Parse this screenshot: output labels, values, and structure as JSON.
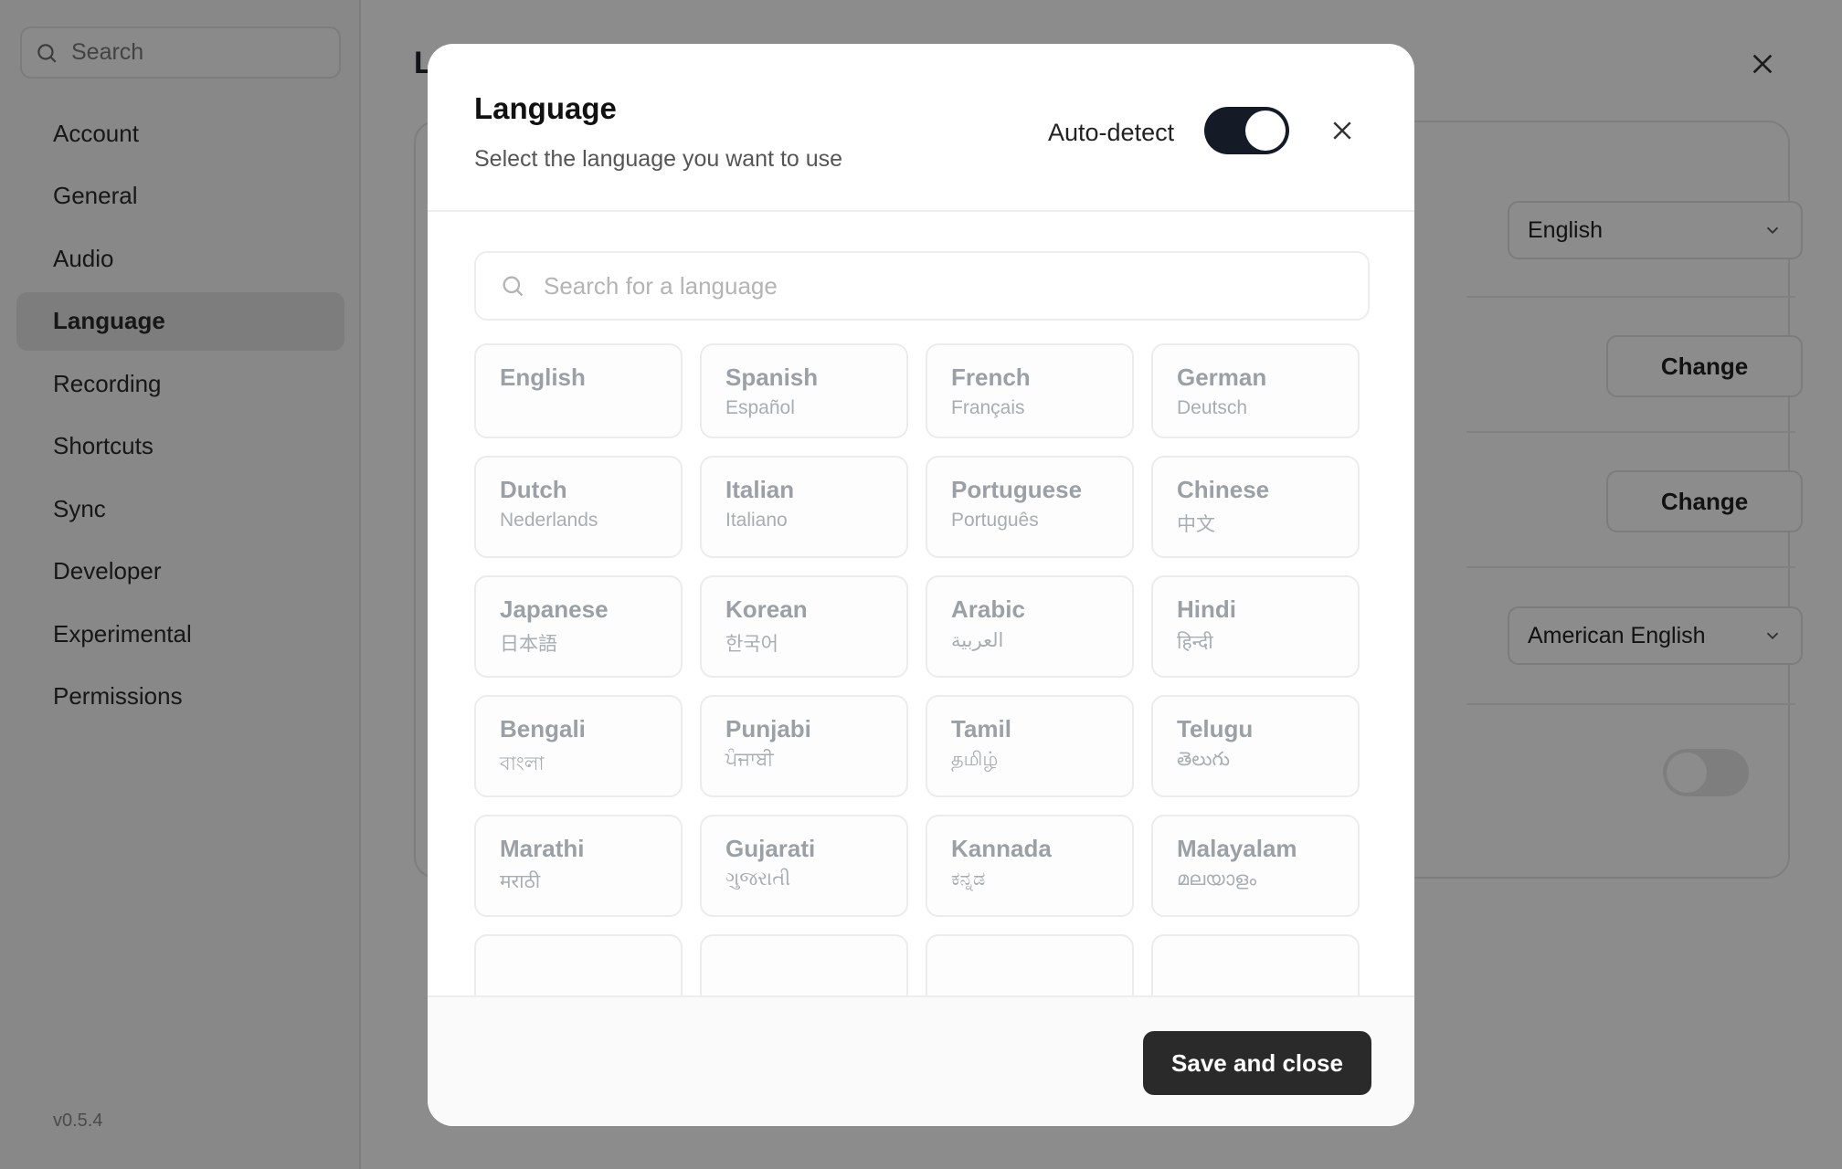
{
  "sidebar": {
    "search_placeholder": "Search",
    "items": [
      {
        "label": "Account",
        "active": false
      },
      {
        "label": "General",
        "active": false
      },
      {
        "label": "Audio",
        "active": false
      },
      {
        "label": "Language",
        "active": true
      },
      {
        "label": "Recording",
        "active": false
      },
      {
        "label": "Shortcuts",
        "active": false
      },
      {
        "label": "Sync",
        "active": false
      },
      {
        "label": "Developer",
        "active": false
      },
      {
        "label": "Experimental",
        "active": false
      },
      {
        "label": "Permissions",
        "active": false
      }
    ],
    "version": "v0.5.4"
  },
  "main": {
    "title": "L",
    "language_select_value": "English",
    "change_button_1": "Change",
    "change_button_2": "Change",
    "dialect_select_value": "American English",
    "toggle_enabled": false
  },
  "modal": {
    "title": "Language",
    "subtitle": "Select the language you want to use",
    "autodetect_label": "Auto-detect",
    "autodetect_enabled": true,
    "search_placeholder": "Search for a language",
    "languages": [
      {
        "name": "English",
        "native": ""
      },
      {
        "name": "Spanish",
        "native": "Español"
      },
      {
        "name": "French",
        "native": "Français"
      },
      {
        "name": "German",
        "native": "Deutsch"
      },
      {
        "name": "Dutch",
        "native": "Nederlands"
      },
      {
        "name": "Italian",
        "native": "Italiano"
      },
      {
        "name": "Portuguese",
        "native": "Português"
      },
      {
        "name": "Chinese",
        "native": "中文"
      },
      {
        "name": "Japanese",
        "native": "日本語"
      },
      {
        "name": "Korean",
        "native": "한국어"
      },
      {
        "name": "Arabic",
        "native": "العربية"
      },
      {
        "name": "Hindi",
        "native": "हिन्दी"
      },
      {
        "name": "Bengali",
        "native": "বাংলা"
      },
      {
        "name": "Punjabi",
        "native": "ਪੰਜਾਬੀ"
      },
      {
        "name": "Tamil",
        "native": "தமிழ்"
      },
      {
        "name": "Telugu",
        "native": "తెలుగు"
      },
      {
        "name": "Marathi",
        "native": "मराठी"
      },
      {
        "name": "Gujarati",
        "native": "ગુજરાતી"
      },
      {
        "name": "Kannada",
        "native": "ಕನ್ನಡ"
      },
      {
        "name": "Malayalam",
        "native": "മലയാളം"
      },
      {
        "name": "",
        "native": ""
      },
      {
        "name": "",
        "native": ""
      },
      {
        "name": "",
        "native": ""
      },
      {
        "name": "",
        "native": ""
      }
    ],
    "save_button": "Save and close"
  },
  "icons": {
    "search": "search-icon",
    "close": "close-icon",
    "chevron": "chevron-down-icon"
  },
  "colors": {
    "toggle_on": "#141a26",
    "save_button": "#2a2a2a",
    "overlay": "rgba(0,0,0,0.45)"
  }
}
